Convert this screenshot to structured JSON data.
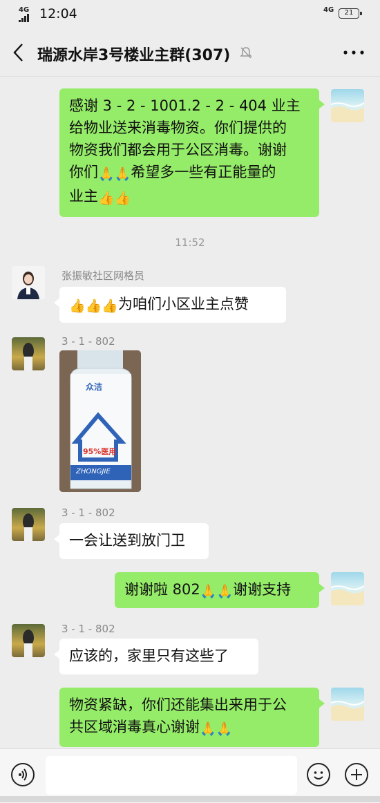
{
  "status_bar": {
    "network_left": "4G",
    "time": "12:04",
    "network_right": "4G",
    "battery": "21"
  },
  "header": {
    "title": "瑞源水岸3号楼业主群(307)",
    "back_icon": "chevron-left-icon",
    "mute_icon": "bell-off-icon",
    "more_icon": "more-dots-icon"
  },
  "messages": [
    {
      "side": "right",
      "lines": [
        "感谢 3 - 2 - 1001.2 - 2 - 404 业主",
        "给物业送来消毒物资。你们提供的",
        "物资我们都会用于公区消毒。谢谢",
        "你们",
        "希望多一些有正能量的",
        "业主"
      ]
    },
    {
      "type": "time",
      "text": "11:52"
    },
    {
      "side": "left",
      "sender": "张振敏社区网格员",
      "text": "为咱们小区业主点赞"
    },
    {
      "side": "left",
      "sender": "3 - 1 - 802",
      "image": {
        "brand": "众洁",
        "label": "95%医用",
        "brand_en": "ZHONGJIE"
      }
    },
    {
      "side": "left",
      "sender": "3 - 1 - 802",
      "text": "一会让送到放门卫"
    },
    {
      "side": "right",
      "text_a": "谢谢啦 802",
      "text_b": "谢谢支持"
    },
    {
      "side": "left",
      "sender": "3 - 1 - 802",
      "text": "应该的，家里只有这些了"
    },
    {
      "side": "right",
      "lines": [
        "物资紧缺，你们还能集出来用于公",
        "共区域消毒真心谢谢"
      ]
    }
  ],
  "emojis": {
    "thumbs_up": "👍",
    "fist": "🙏"
  },
  "input_bar": {
    "placeholder": ""
  },
  "colors": {
    "green_bubble": "#95ec69",
    "background": "#ededed"
  }
}
